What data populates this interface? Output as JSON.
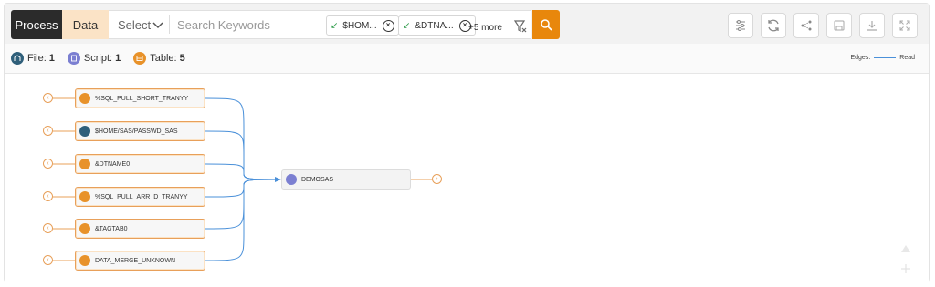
{
  "toolbar": {
    "process_label": "Process",
    "data_label": "Data",
    "select_label": "Select",
    "search_placeholder": "Search Keywords",
    "chips": [
      {
        "label": "$HOM..."
      },
      {
        "label": "&DTNA..."
      }
    ],
    "more_label": "+5 more"
  },
  "stats": {
    "file_label": "File:",
    "file_count": "1",
    "script_label": "Script:",
    "script_count": "1",
    "table_label": "Table:",
    "table_count": "5"
  },
  "legend": {
    "edges_label": "Edges:",
    "read_label": "Read"
  },
  "graph": {
    "sources": [
      {
        "label": "%SQL_PULL_SHORT_TRANYY",
        "kind": "table"
      },
      {
        "label": "$HOME/SAS/PASSWD_SAS",
        "kind": "file"
      },
      {
        "label": "&DTNAME0",
        "kind": "table"
      },
      {
        "label": "%SQL_PULL_ARR_D_TRANYY",
        "kind": "table"
      },
      {
        "label": "&TAGTAB0",
        "kind": "table"
      },
      {
        "label": "DATA_MERGE_UNKNOWN",
        "kind": "table"
      }
    ],
    "target": {
      "label": "DEMOSAS",
      "kind": "script"
    }
  },
  "colors": {
    "accent": "#e8870c",
    "table": "#e8922a",
    "file": "#2f5f7a",
    "script": "#7b7fd1",
    "edge": "#4a90d9"
  }
}
